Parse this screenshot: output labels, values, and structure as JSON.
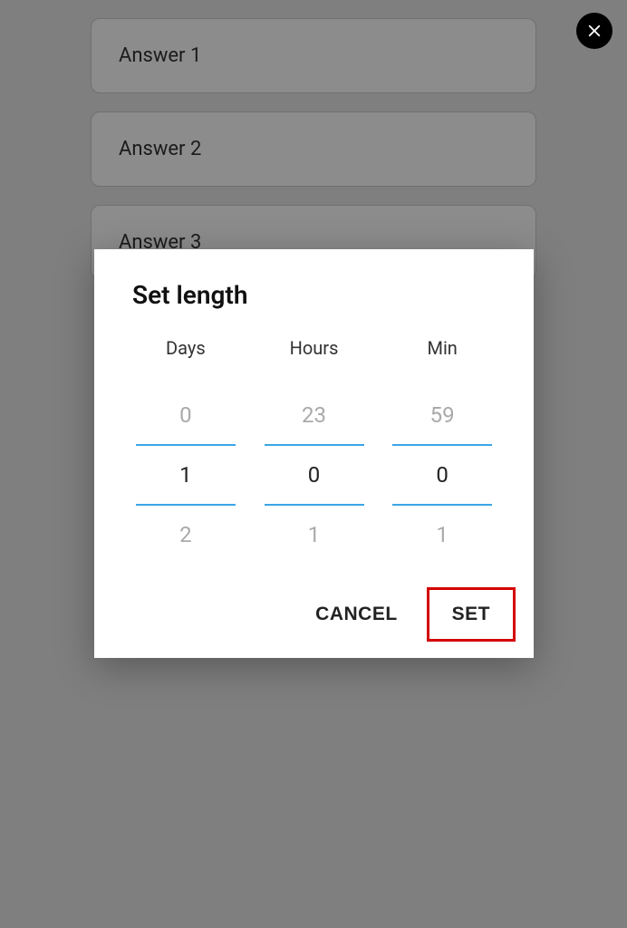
{
  "answers": [
    "Answer 1",
    "Answer 2",
    "Answer 3"
  ],
  "dialog": {
    "title": "Set length",
    "columns": {
      "days": {
        "label": "Days",
        "prev": "0",
        "selected": "1",
        "next": "2"
      },
      "hours": {
        "label": "Hours",
        "prev": "23",
        "selected": "0",
        "next": "1"
      },
      "min": {
        "label": "Min",
        "prev": "59",
        "selected": "0",
        "next": "1"
      }
    },
    "actions": {
      "cancel": "CANCEL",
      "set": "SET"
    }
  }
}
